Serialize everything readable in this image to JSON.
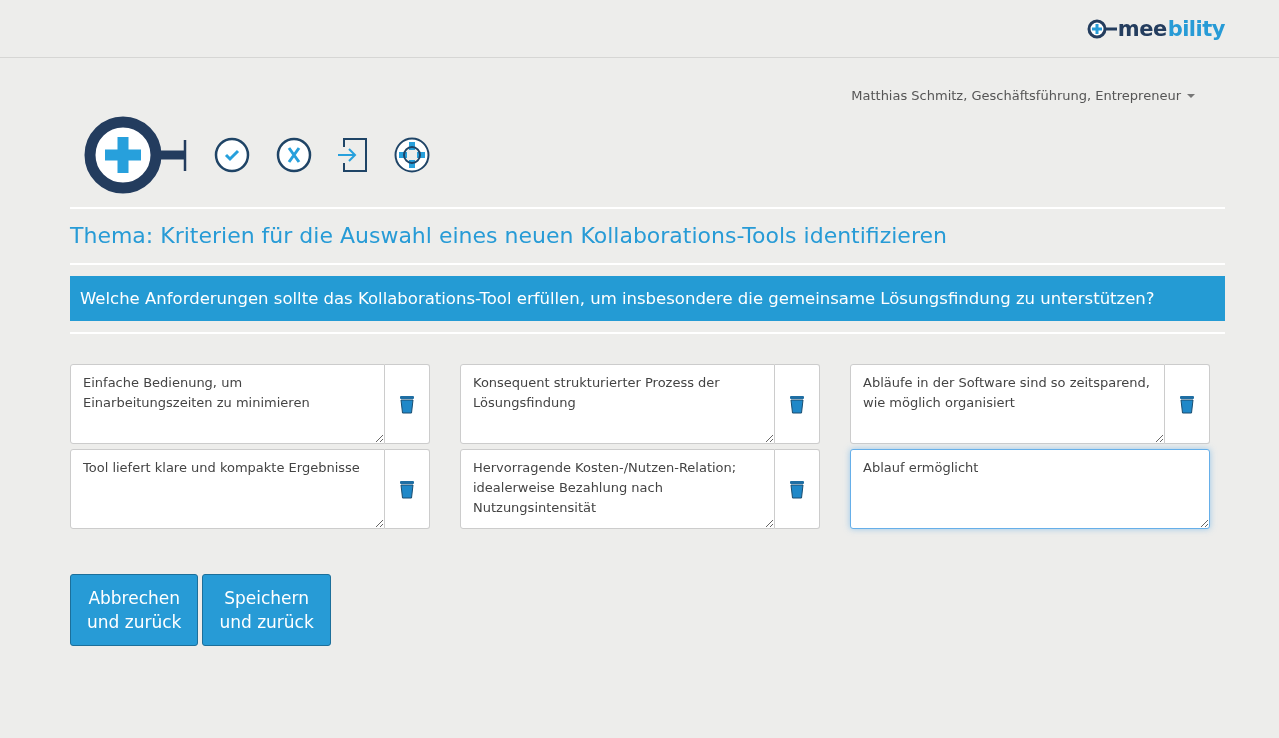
{
  "logo": {
    "part_1": "mee",
    "part_2": "bility"
  },
  "user_menu": {
    "label": "Matthias Schmitz, Geschäftsführung, Entrepreneur"
  },
  "topic": "Thema: Kriterien für die Auswahl eines neuen Kollaborations-Tools identifizieren",
  "question": "Welche Anforderungen sollte das Kollaborations-Tool erfüllen, um insbesondere die gemeinsame Lösungsfindung zu unterstützen?",
  "answers": [
    {
      "kind": "saved",
      "text": "Einfache Bedienung, um Einarbeitungszeiten zu minimieren",
      "focused": false
    },
    {
      "kind": "saved",
      "text": "Konsequent strukturierter Prozess der Lösungsfindung",
      "focused": false
    },
    {
      "kind": "saved",
      "text": "Abläufe in der Software sind so zeitsparend, wie möglich organisiert",
      "focused": false
    },
    {
      "kind": "saved",
      "text": "Tool liefert klare und kompakte Ergebnisse",
      "focused": false
    },
    {
      "kind": "saved",
      "text": "Hervorragende Kosten-/Nutzen-Relation; idealerweise Bezahlung nach Nutzungsintensität",
      "focused": false
    },
    {
      "kind": "editing",
      "text": "Ablauf ermöglicht",
      "focused": true
    }
  ],
  "buttons": [
    {
      "line_1": "Abbrechen",
      "line_2": "und zurück"
    },
    {
      "line_1": "Speichern",
      "line_2": "und zurück"
    }
  ]
}
